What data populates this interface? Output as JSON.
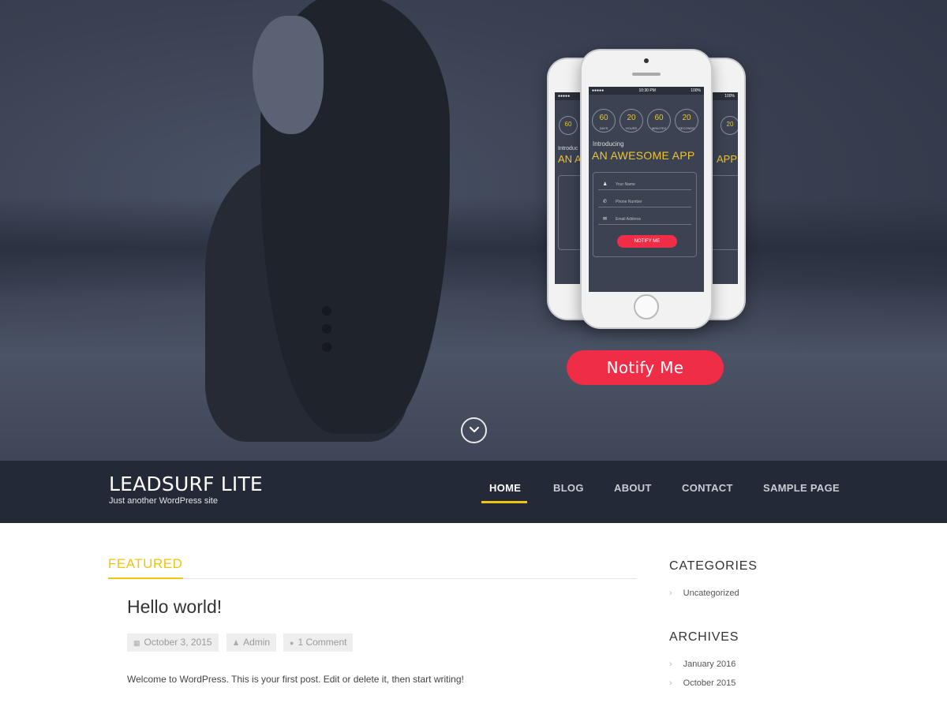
{
  "hero": {
    "phone_center": {
      "status_time": "10:30 PM",
      "status_signal": "●●●●●",
      "status_battery": "100%",
      "counters": [
        {
          "value": "60",
          "unit": "DAYS"
        },
        {
          "value": "20",
          "unit": "HOURS"
        },
        {
          "value": "60",
          "unit": "MINUTES"
        },
        {
          "value": "20",
          "unit": "SECONDS"
        }
      ],
      "introducing": "Introducing",
      "headline": "AN AWESOME APP",
      "fields": [
        {
          "icon": "♟",
          "placeholder": "Your Name"
        },
        {
          "icon": "✆",
          "placeholder": "Phone Number"
        },
        {
          "icon": "✉",
          "placeholder": "Email Address"
        }
      ],
      "notify_label": "NOTIFY ME"
    },
    "phone_left": {
      "counter": "60",
      "unit": "DAYS",
      "introducing": "Introduc",
      "headline": "AN A",
      "status_signal": "●●●●●"
    },
    "phone_right": {
      "counter": "20",
      "unit": "SECONDS",
      "headline": "APP",
      "status_battery": "100%"
    },
    "notify_button": "Notify Me"
  },
  "header": {
    "site_title": "LEADSURF LITE",
    "tagline": "Just another WordPress site",
    "nav": [
      "HOME",
      "BLOG",
      "ABOUT",
      "CONTACT",
      "SAMPLE PAGE"
    ],
    "active_nav": "HOME",
    "accent_color": "#f1c40f"
  },
  "main": {
    "section_label": "FEATURED",
    "post": {
      "title": "Hello world!",
      "date": "October 3, 2015",
      "author": "Admin",
      "comments": "1 Comment",
      "excerpt": "Welcome to WordPress. This is your first post. Edit or delete it, then start writing!"
    }
  },
  "sidebar": {
    "categories_title": "CATEGORIES",
    "categories": [
      "Uncategorized"
    ],
    "archives_title": "ARCHIVES",
    "archives": [
      "January 2016",
      "October 2015"
    ]
  }
}
